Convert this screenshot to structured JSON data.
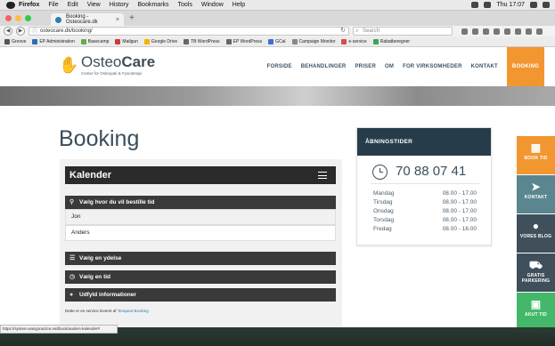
{
  "menubar": {
    "app": "Firefox",
    "items": [
      "File",
      "Edit",
      "View",
      "History",
      "Bookmarks",
      "Tools",
      "Window",
      "Help"
    ],
    "clock": "Thu 17:07"
  },
  "tab": {
    "title": "Booking - Osteocare.dk",
    "close": "×",
    "new_tab": "+"
  },
  "navbar": {
    "url": "osteocare.dk/booking/",
    "search_placeholder": "Search"
  },
  "bookmarks": [
    "Groove",
    "EP Administration",
    "Basecamp",
    "Mailgun",
    "Google Drive",
    "TB WordPress",
    "EP WordPress",
    "GCal",
    "Campaign Monitor",
    "e-service",
    "Rabatberegner"
  ],
  "site": {
    "logo_light": "Osteo",
    "logo_bold": "Care",
    "logo_tagline": "Center for Osteopati & Fysioterapi",
    "nav": [
      "FORSIDE",
      "BEHANDLINGER",
      "PRISER",
      "OM",
      "FOR VIRKSOMHEDER",
      "KONTAKT",
      "BOOKING"
    ],
    "active_nav": "BOOKING"
  },
  "main": {
    "title": "Booking",
    "calendar_title": "Kalender",
    "steps": [
      "Vælg hvor du vil bestille tid",
      "Vælg en ydelse",
      "Vælg en tid",
      "Udfyld informationer"
    ],
    "locations": [
      "Jon",
      "Anders"
    ],
    "credit_prefix": "Dette er en service leveret af ",
    "credit_link": "Terapeut Booking"
  },
  "hours": {
    "title": "ÅBNINGSTIDER",
    "phone": "70 88 07 41",
    "days": [
      {
        "day": "Mandag",
        "time": "08.00 - 17.00"
      },
      {
        "day": "Tirsdag",
        "time": "08.00 - 17.00"
      },
      {
        "day": "Onsdag",
        "time": "08.00 - 17.00"
      },
      {
        "day": "Torsdag",
        "time": "08.00 - 17.00"
      },
      {
        "day": "Fredag",
        "time": "08.00 - 16.00"
      }
    ]
  },
  "sidebar": [
    {
      "label": "BOOK TID",
      "color": "#f29630",
      "icon": "calendar-icon",
      "glyph": "▦"
    },
    {
      "label": "KONTAKT",
      "color": "#5a8690",
      "icon": "paper-plane-icon",
      "glyph": "➤"
    },
    {
      "label": "VORES BLOG",
      "color": "#3f4f5b",
      "icon": "chat-icon",
      "glyph": "●"
    },
    {
      "label": "GRATIS PARKERING",
      "color": "#3f4f5b",
      "icon": "car-icon",
      "glyph": "⛟"
    },
    {
      "label": "AKUT TID",
      "color": "#43b86a",
      "icon": "calendar-plus-icon",
      "glyph": "▣"
    }
  ],
  "status_url": "https://system.easypractice.net/book/anders-kalender#"
}
